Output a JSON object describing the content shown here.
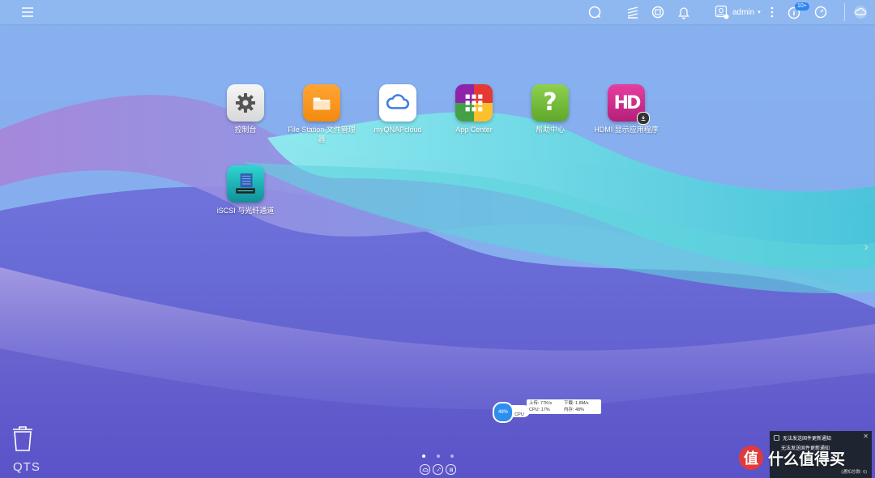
{
  "topbar": {
    "user": "admin",
    "notification_badge": "10+"
  },
  "apps": [
    {
      "label": "控制台",
      "icon": "gear-icon",
      "color": "#e8e8e8"
    },
    {
      "label": "File Station 文件管理器",
      "icon": "folder-icon",
      "color": "#f7931e"
    },
    {
      "label": "myQNAPcloud",
      "icon": "cloud-icon",
      "color": "#ffffff"
    },
    {
      "label": "App Center",
      "icon": "grid-icon",
      "color": "#e53935"
    },
    {
      "label": "帮助中心",
      "icon": "question-icon",
      "color": "#7cc242"
    },
    {
      "label": "HDMI 显示应用程序",
      "icon": "hd-icon",
      "color": "#d92e8f"
    },
    {
      "label": "iSCSI 与光纤通道",
      "icon": "storage-icon",
      "color": "#1ec6c6"
    }
  ],
  "desktop": {
    "brand": "QTS"
  },
  "monitor": {
    "percent": "48%",
    "cpu_label": "CPU",
    "upload": "上传: 77K/s",
    "download": "下载: 1.8M/s",
    "cpu": "CPU: 17%",
    "memory": "内存: 48%"
  },
  "notification": {
    "title": "无法发送固件更新通知",
    "body": "无法发送固件更新通知",
    "count": "(通知总数: 6)"
  },
  "watermark": {
    "logo": "值",
    "text": "什么值得买"
  }
}
